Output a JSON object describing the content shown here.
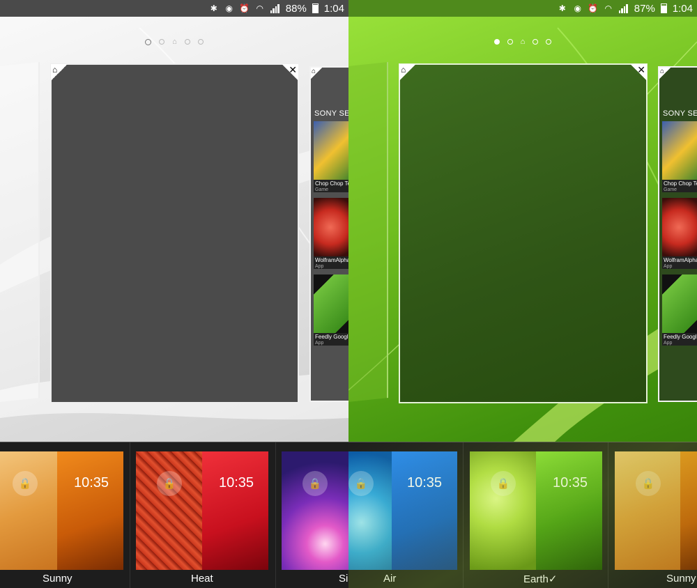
{
  "screens": [
    {
      "status": {
        "battery_text": "88%",
        "time": "1:04",
        "battery_level": 0.88
      },
      "pager": {
        "dots": 5,
        "active_index": 0
      }
    },
    {
      "status": {
        "battery_text": "87%",
        "time": "1:04",
        "battery_level": 0.87
      },
      "pager": {
        "dots": 5,
        "active_index": 0
      }
    }
  ],
  "side_panel": {
    "title": "SONY SELECT",
    "apps": [
      {
        "name": "Chop Chop Tennis",
        "kind": "Game"
      },
      {
        "name": "WolframAlpha",
        "kind": "App"
      },
      {
        "name": "Feedly Google Re",
        "kind": "App"
      }
    ]
  },
  "themes": [
    {
      "label": "Sunny",
      "clock": "10:35"
    },
    {
      "label": "Heat",
      "clock": "10:35"
    },
    {
      "label": "Si",
      "clock": ""
    },
    {
      "label": "Air",
      "clock": "10:35"
    },
    {
      "label": "Earth✓",
      "clock": "10:35"
    },
    {
      "label": "Sunny",
      "clock": ""
    }
  ],
  "colors": {
    "light_bg": "#e9e9e9",
    "green_bg": "#6fbd1f",
    "strip_bg": "#1d1d1d"
  },
  "icons": [
    "bluetooth-icon",
    "alarm-icon",
    "clock-icon",
    "wifi-icon",
    "signal-icon",
    "battery-icon",
    "home-icon",
    "close-icon",
    "lock-icon"
  ]
}
